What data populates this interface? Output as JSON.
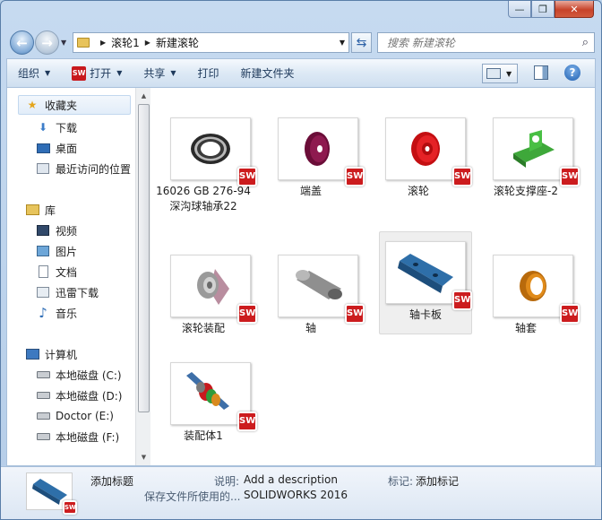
{
  "window": {
    "caption_buttons": [
      "—",
      "❐",
      "✕"
    ]
  },
  "address": {
    "crumbs": [
      "滚轮1",
      "新建滚轮"
    ]
  },
  "search": {
    "placeholder": "搜索 新建滚轮"
  },
  "toolbar": {
    "organize": "组织",
    "open": "打开",
    "open_icon": "SW",
    "share": "共享",
    "print": "打印",
    "new_folder": "新建文件夹"
  },
  "nav": {
    "favorites": "收藏夹",
    "favorites_items": [
      "下载",
      "桌面",
      "最近访问的位置"
    ],
    "libraries": "库",
    "library_items": [
      "视频",
      "图片",
      "文档",
      "迅雷下载",
      "音乐"
    ],
    "computer": "计算机",
    "computer_items": [
      "本地磁盘 (C:)",
      "本地磁盘 (D:)",
      "Doctor (E:)",
      "本地磁盘 (F:)"
    ]
  },
  "files": [
    {
      "label": "16026 GB 276-94 深沟球轴承22",
      "badge": "SW",
      "kind": "bearing"
    },
    {
      "label": "端盖",
      "badge": "SW",
      "kind": "endcap"
    },
    {
      "label": "滚轮",
      "badge": "SW",
      "kind": "wheel"
    },
    {
      "label": "滚轮支撑座-2",
      "badge": "SW",
      "kind": "bracket"
    },
    {
      "label": "滚轮装配",
      "badge": "SW",
      "kind": "wheelasm"
    },
    {
      "label": "轴",
      "badge": "SW",
      "kind": "shaft"
    },
    {
      "label": "轴卡板",
      "badge": "SW",
      "kind": "plate",
      "selected": true
    },
    {
      "label": "轴套",
      "badge": "SW",
      "kind": "sleeve"
    },
    {
      "label": "装配体1",
      "badge": "SW",
      "kind": "assembly"
    }
  ],
  "details": {
    "title_value": "添加标题",
    "desc_label": "说明:",
    "desc_value": "Add a description",
    "tags_label": "标记:",
    "tags_value": "添加标记",
    "saved_with": "保存文件所使用的...",
    "saved_value": "SOLIDWORKS 2016",
    "badge": "SW"
  },
  "colors": {
    "sw_red": "#cc1c1e",
    "selection": "#efefef"
  }
}
